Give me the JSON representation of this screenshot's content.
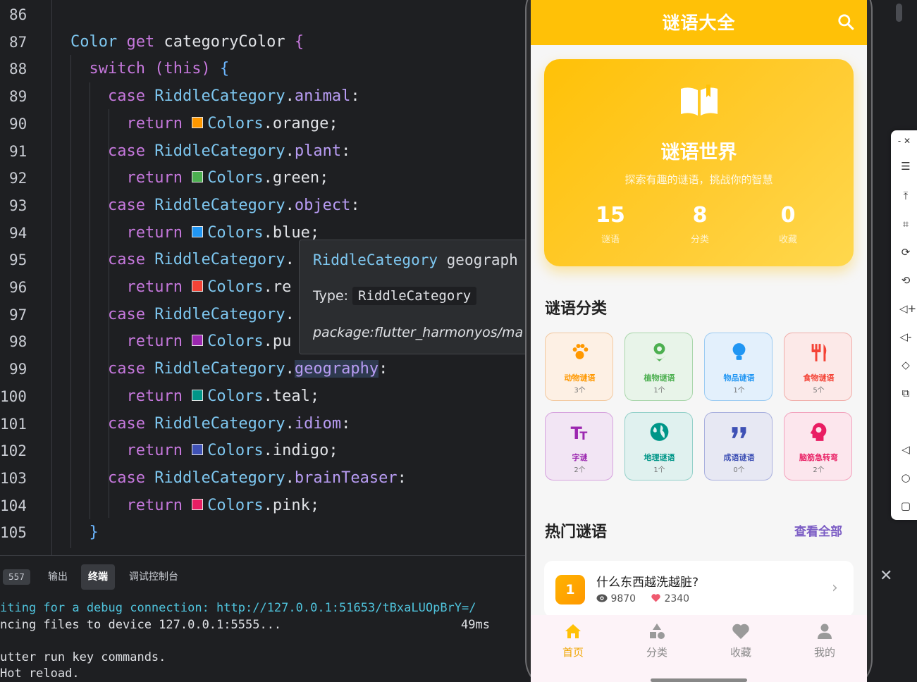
{
  "editor": {
    "lines": [
      {
        "n": "86",
        "segs": []
      },
      {
        "n": "87",
        "segs": [
          {
            "t": "Color ",
            "c": "ty"
          },
          {
            "t": "get ",
            "c": "kw"
          },
          {
            "t": "categoryColor ",
            "c": "id"
          },
          {
            "t": "{",
            "c": "kw"
          }
        ]
      },
      {
        "n": "88",
        "segs": [
          {
            "t": "  switch ",
            "c": "kw"
          },
          {
            "t": "(this) ",
            "c": "kw"
          },
          {
            "t": "{",
            "c": "br"
          }
        ]
      },
      {
        "n": "89",
        "segs": [
          {
            "t": "    case ",
            "c": "kw"
          },
          {
            "t": "RiddleCategory",
            "c": "cls"
          },
          {
            "t": ".",
            "c": "id"
          },
          {
            "t": "animal",
            "c": "fld"
          },
          {
            "t": ":",
            "c": "id"
          }
        ]
      },
      {
        "n": "90",
        "segs": [
          {
            "t": "      return ",
            "c": "kw"
          },
          {
            "sw": "#ff9800"
          },
          {
            "t": "Colors",
            "c": "cls"
          },
          {
            "t": ".orange;",
            "c": "id"
          }
        ]
      },
      {
        "n": "91",
        "segs": [
          {
            "t": "    case ",
            "c": "kw"
          },
          {
            "t": "RiddleCategory",
            "c": "cls"
          },
          {
            "t": ".",
            "c": "id"
          },
          {
            "t": "plant",
            "c": "fld"
          },
          {
            "t": ":",
            "c": "id"
          }
        ]
      },
      {
        "n": "92",
        "segs": [
          {
            "t": "      return ",
            "c": "kw"
          },
          {
            "sw": "#4caf50"
          },
          {
            "t": "Colors",
            "c": "cls"
          },
          {
            "t": ".green;",
            "c": "id"
          }
        ]
      },
      {
        "n": "93",
        "segs": [
          {
            "t": "    case ",
            "c": "kw"
          },
          {
            "t": "RiddleCategory",
            "c": "cls"
          },
          {
            "t": ".",
            "c": "id"
          },
          {
            "t": "object",
            "c": "fld"
          },
          {
            "t": ":",
            "c": "id"
          }
        ]
      },
      {
        "n": "94",
        "segs": [
          {
            "t": "      return ",
            "c": "kw"
          },
          {
            "sw": "#2196f3"
          },
          {
            "t": "Colors",
            "c": "cls"
          },
          {
            "t": ".blue;",
            "c": "id"
          }
        ]
      },
      {
        "n": "95",
        "segs": [
          {
            "t": "    case ",
            "c": "kw"
          },
          {
            "t": "RiddleCategory",
            "c": "cls"
          },
          {
            "t": ".",
            "c": "id"
          }
        ]
      },
      {
        "n": "96",
        "segs": [
          {
            "t": "      return ",
            "c": "kw"
          },
          {
            "sw": "#f44336"
          },
          {
            "t": "Colors",
            "c": "cls"
          },
          {
            "t": ".re",
            "c": "id"
          }
        ]
      },
      {
        "n": "97",
        "segs": [
          {
            "t": "    case ",
            "c": "kw"
          },
          {
            "t": "RiddleCategory",
            "c": "cls"
          },
          {
            "t": ".",
            "c": "id"
          }
        ]
      },
      {
        "n": "98",
        "segs": [
          {
            "t": "      return ",
            "c": "kw"
          },
          {
            "sw": "#9c27b0"
          },
          {
            "t": "Colors",
            "c": "cls"
          },
          {
            "t": ".pu",
            "c": "id"
          }
        ]
      },
      {
        "n": "99",
        "segs": [
          {
            "t": "    case ",
            "c": "kw"
          },
          {
            "t": "RiddleCategory",
            "c": "cls"
          },
          {
            "t": ".",
            "c": "id"
          },
          {
            "t": "geography",
            "c": "fld",
            "hl": true
          },
          {
            "t": ":",
            "c": "id"
          }
        ]
      },
      {
        "n": "100",
        "segs": [
          {
            "t": "      return ",
            "c": "kw"
          },
          {
            "sw": "#009688"
          },
          {
            "t": "Colors",
            "c": "cls"
          },
          {
            "t": ".teal;",
            "c": "id"
          }
        ]
      },
      {
        "n": "101",
        "segs": [
          {
            "t": "    case ",
            "c": "kw"
          },
          {
            "t": "RiddleCategory",
            "c": "cls"
          },
          {
            "t": ".",
            "c": "id"
          },
          {
            "t": "idiom",
            "c": "fld"
          },
          {
            "t": ":",
            "c": "id"
          }
        ]
      },
      {
        "n": "102",
        "segs": [
          {
            "t": "      return ",
            "c": "kw"
          },
          {
            "sw": "#3f51b5"
          },
          {
            "t": "Colors",
            "c": "cls"
          },
          {
            "t": ".indigo;",
            "c": "id"
          }
        ]
      },
      {
        "n": "103",
        "segs": [
          {
            "t": "    case ",
            "c": "kw"
          },
          {
            "t": "RiddleCategory",
            "c": "cls"
          },
          {
            "t": ".",
            "c": "id"
          },
          {
            "t": "brainTeaser",
            "c": "fld"
          },
          {
            "t": ":",
            "c": "id"
          }
        ]
      },
      {
        "n": "104",
        "segs": [
          {
            "t": "      return ",
            "c": "kw"
          },
          {
            "sw": "#e91e63"
          },
          {
            "t": "Colors",
            "c": "cls"
          },
          {
            "t": ".pink;",
            "c": "id"
          }
        ]
      },
      {
        "n": "105",
        "segs": [
          {
            "t": "  }",
            "c": "br"
          }
        ]
      }
    ]
  },
  "tooltip": {
    "sig_class": "RiddleCategory",
    "sig_name": " geograph",
    "type_label": "Type:",
    "type_value": "RiddleCategory",
    "package": "package:flutter_harmonyos/ma"
  },
  "panel": {
    "badge": "557",
    "tabs": [
      "输出",
      "终端",
      "调试控制台"
    ],
    "active_tab": "终端",
    "terminal": [
      "iting for a debug connection: http://127.0.0.1:51653/tBxaLUOpBrY=/",
      "ncing files to device 127.0.0.1:5555...",
      "",
      "utter run key commands.",
      "Hot reload."
    ],
    "elapsed": "49ms"
  },
  "app": {
    "title": "谜语大全",
    "hero": {
      "title": "谜语世界",
      "subtitle": "探索有趣的谜语，挑战你的智慧",
      "stats": [
        {
          "num": "15",
          "label": "谜语"
        },
        {
          "num": "8",
          "label": "分类"
        },
        {
          "num": "0",
          "label": "收藏"
        }
      ]
    },
    "categories_title": "谜语分类",
    "categories": [
      {
        "name": "动物谜语",
        "count": "3个",
        "icon": "paw-icon",
        "color": "#ff9800"
      },
      {
        "name": "植物谜语",
        "count": "1个",
        "icon": "flower-icon",
        "color": "#4caf50"
      },
      {
        "name": "物品谜语",
        "count": "1个",
        "icon": "lightbulb-icon",
        "color": "#2196f3"
      },
      {
        "name": "食物谜语",
        "count": "5个",
        "icon": "fork-knife-icon",
        "color": "#f44336"
      },
      {
        "name": "字谜",
        "count": "2个",
        "icon": "text-icon",
        "color": "#9c27b0"
      },
      {
        "name": "地理谜语",
        "count": "1个",
        "icon": "globe-icon",
        "color": "#009688"
      },
      {
        "name": "成语谜语",
        "count": "0个",
        "icon": "quote-icon",
        "color": "#3f51b5"
      },
      {
        "name": "脑筋急转弯",
        "count": "2个",
        "icon": "brain-icon",
        "color": "#e91e63"
      }
    ],
    "hot_title": "热门谜语",
    "see_all": "查看全部",
    "hot_items": [
      {
        "rank": "1",
        "question": "什么东西越洗越脏?",
        "views": "9870",
        "likes": "2340"
      }
    ],
    "nav": [
      {
        "label": "首页",
        "icon": "home-icon",
        "active": true
      },
      {
        "label": "分类",
        "icon": "category-icon",
        "active": false
      },
      {
        "label": "收藏",
        "icon": "heart-icon",
        "active": false
      },
      {
        "label": "我的",
        "icon": "person-icon",
        "active": false
      }
    ],
    "accent": "#ffc107"
  }
}
